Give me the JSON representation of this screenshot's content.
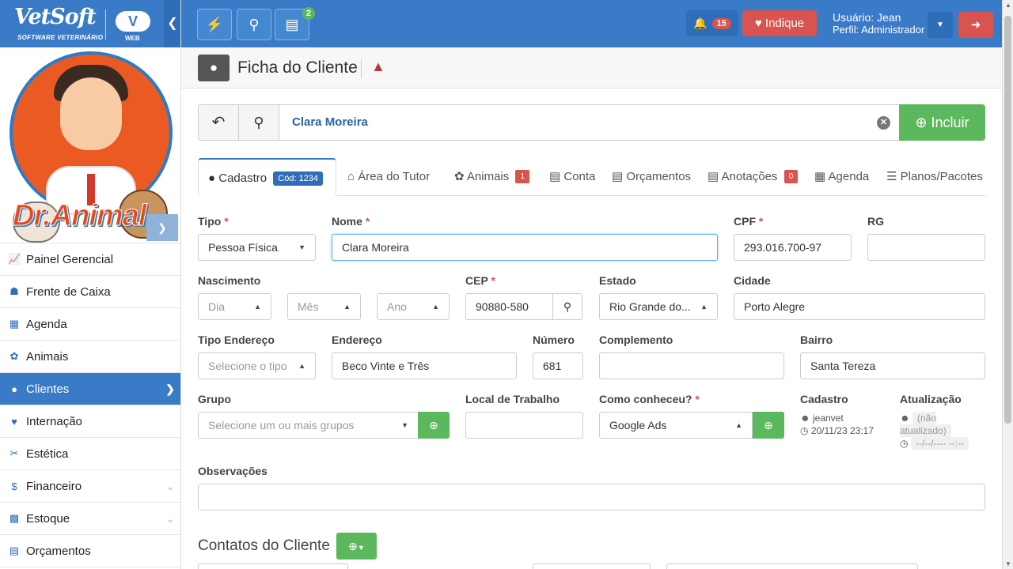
{
  "brand": {
    "name": "VetSoft",
    "tagline": "SOFTWARE VETERINÁRIO",
    "badge": "V",
    "badge_sub": "WEB",
    "clinic_logo_text": "Dr.Animal"
  },
  "sidebar": {
    "items": [
      {
        "label": "Painel Gerencial",
        "icon": "chart-line-icon",
        "active": false
      },
      {
        "label": "Frente de Caixa",
        "icon": "basket-icon",
        "active": false
      },
      {
        "label": "Agenda",
        "icon": "calendar-icon",
        "active": false
      },
      {
        "label": "Animais",
        "icon": "paw-icon",
        "active": false
      },
      {
        "label": "Clientes",
        "icon": "user-icon",
        "active": true
      },
      {
        "label": "Internação",
        "icon": "heartbeat-icon",
        "active": false
      },
      {
        "label": "Estética",
        "icon": "scissors-icon",
        "active": false
      },
      {
        "label": "Financeiro",
        "icon": "dollar-icon",
        "active": false
      },
      {
        "label": "Estoque",
        "icon": "boxes-icon",
        "active": false
      },
      {
        "label": "Orçamentos",
        "icon": "file-list-icon",
        "active": false
      }
    ]
  },
  "topbar": {
    "cashier_badge": "2",
    "notifications_count": "15",
    "indique_label": "Indique",
    "user_line": "Usuário: Jean",
    "profile_line": "Perfil: Administrador"
  },
  "page": {
    "title": "Ficha do Cliente"
  },
  "search": {
    "value": "Clara Moreira",
    "add_label": "Incluir"
  },
  "tabs": [
    {
      "label": "Cadastro",
      "badge": "Cód: 1234",
      "icon": "user-icon",
      "active": true
    },
    {
      "label": "Área do Tutor",
      "icon": "home-icon"
    },
    {
      "label": "Animais",
      "badge": "1",
      "icon": "paw-icon"
    },
    {
      "label": "Conta",
      "icon": "list-icon"
    },
    {
      "label": "Orçamentos",
      "icon": "file-list-icon"
    },
    {
      "label": "Anotações",
      "badge": "0",
      "icon": "book-icon"
    },
    {
      "label": "Agenda",
      "icon": "calendar-icon"
    },
    {
      "label": "Planos/Pacotes",
      "icon": "checklist-icon"
    }
  ],
  "form": {
    "tipo": {
      "label": "Tipo",
      "value": "Pessoa Física"
    },
    "nome": {
      "label": "Nome",
      "value": "Clara Moreira"
    },
    "cpf": {
      "label": "CPF",
      "value": "293.016.700-97"
    },
    "rg": {
      "label": "RG",
      "value": ""
    },
    "nascimento": {
      "label": "Nascimento",
      "dia": "Dia",
      "mes": "Mês",
      "ano": "Ano"
    },
    "cep": {
      "label": "CEP",
      "value": "90880-580"
    },
    "estado": {
      "label": "Estado",
      "value": "Rio Grande do..."
    },
    "cidade": {
      "label": "Cidade",
      "value": "Porto Alegre"
    },
    "tipo_endereco": {
      "label": "Tipo Endereço",
      "placeholder": "Selecione o tipo"
    },
    "endereco": {
      "label": "Endereço",
      "value": "Beco Vinte e Três"
    },
    "numero": {
      "label": "Número",
      "value": "681"
    },
    "complemento": {
      "label": "Complemento",
      "value": ""
    },
    "bairro": {
      "label": "Bairro",
      "value": "Santa Tereza"
    },
    "grupo": {
      "label": "Grupo",
      "placeholder": "Selecione um ou mais grupos"
    },
    "local_trabalho": {
      "label": "Local de Trabalho",
      "value": ""
    },
    "como_conheceu": {
      "label": "Como conheceu?",
      "value": "Google Ads"
    },
    "cadastro": {
      "label": "Cadastro",
      "user": "jeanvet",
      "datetime": "20/11/23 23:17"
    },
    "atualizacao": {
      "label": "Atualização",
      "user": "(não atualizado)",
      "datetime": "--/--/---- --:--"
    },
    "observacoes": {
      "label": "Observações",
      "value": ""
    }
  },
  "contacts": {
    "title": "Contatos do Cliente"
  }
}
